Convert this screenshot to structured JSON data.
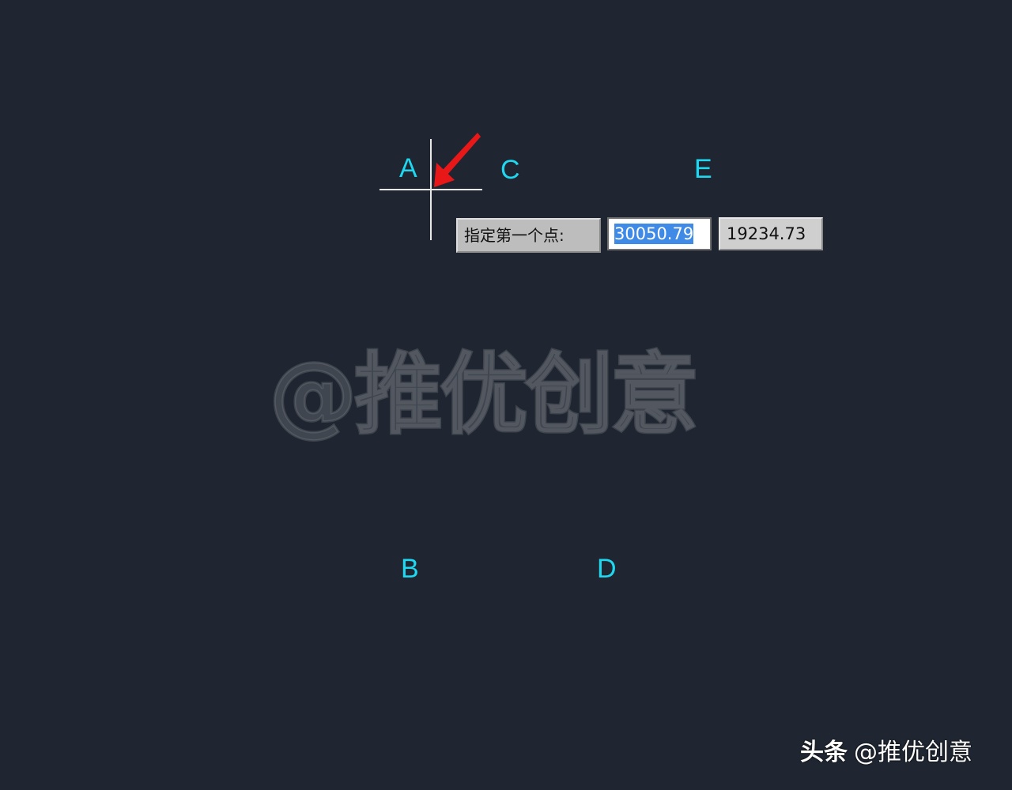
{
  "drawing": {
    "points": {
      "a": "A",
      "b": "B",
      "c": "C",
      "d": "D",
      "e": "E"
    }
  },
  "command_tooltip": {
    "prompt": "指定第一个点:",
    "x_value": "30050.79",
    "y_value": "19234.73"
  },
  "watermark": {
    "center_text": "@推优创意",
    "corner_brand": "头条",
    "corner_handle": "@推优创意"
  },
  "colors": {
    "background": "#1f2631",
    "point_label": "#1fd7ef",
    "crosshair": "#e8e8e8",
    "arrow": "#e81818",
    "selection": "#3f8ae6"
  },
  "icons": {
    "cursor": "crosshair-cursor-icon",
    "pointer_arrow": "red-arrow-icon"
  }
}
